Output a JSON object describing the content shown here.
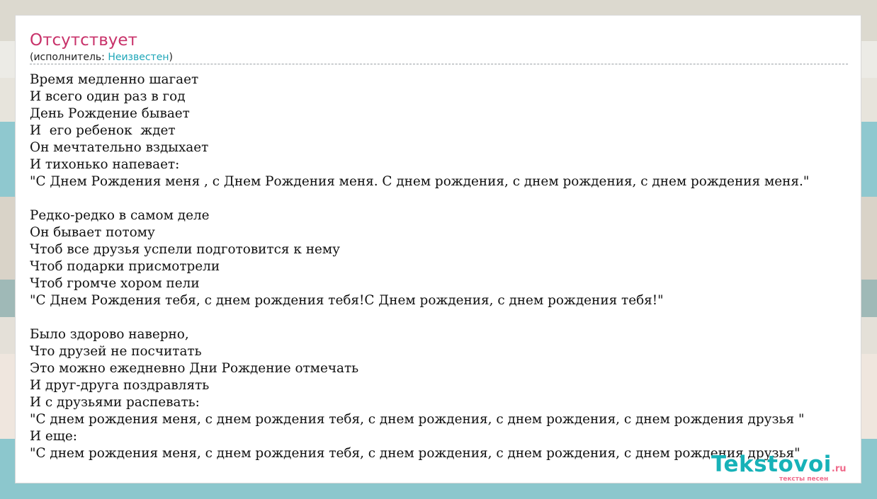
{
  "song": {
    "title": "Отсутствует",
    "performer_prefix": "(исполнитель: ",
    "performer_name": "Неизвестен",
    "performer_suffix": ")"
  },
  "lyrics": [
    "Время медленно шагает",
    "И всего один раз в год",
    "День Рождение бывает",
    "И  его ребенок  ждет",
    "Он мечтательно вздыхает",
    "И тихонько напевает:",
    "\"С Днем Рождения меня , с Днем Рождения меня. С днем рождения, с днем рождения, с днем рождения меня.\"",
    "",
    "Редко-редко в самом деле",
    "Он бывает потому",
    "Чтоб все друзья успели подготовится к нему",
    "Чтоб подарки присмотрели",
    "Чтоб громче хором пели",
    "\"С Днем Рождения тебя, с днем рождения тебя!С Днем рождения, с днем рождения тебя!\"",
    "",
    "Было здорово наверно,",
    "Что друзей не посчитать",
    "Это можно ежедневно Дни Рождение отмечать",
    "И друг-друга поздравлять",
    "И с друзьями распевать:",
    "\"С днем рождения меня, с днем рождения тебя, с днем рождения, с днем рождения, с днем рождения друзья \"",
    "И еще:",
    "\"С днем рождения меня, с днем рождения тебя, с днем рождения, с днем рождения, с днем рождения друзья\""
  ],
  "logo": {
    "main": "Tekstovoi",
    "tld": ".ru",
    "tagline": "тексты песен"
  },
  "colors": {
    "title": "#c8326a",
    "artist_link": "#1ea6b8",
    "logo_main": "#17b2b8",
    "logo_accent": "#f06b8b"
  }
}
